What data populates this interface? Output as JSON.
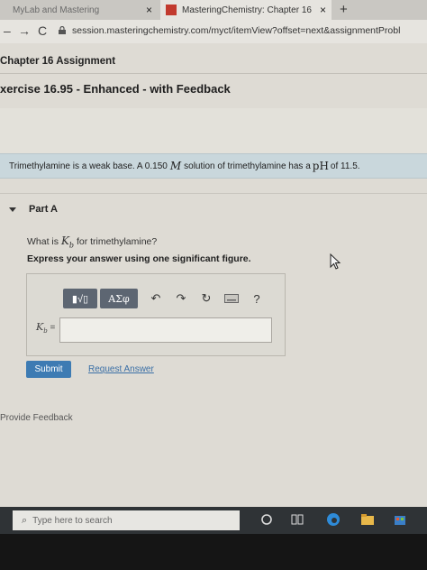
{
  "browser": {
    "tabs": [
      {
        "title": "MyLab and Mastering",
        "active": false
      },
      {
        "title": "MasteringChemistry: Chapter 16",
        "active": true
      }
    ],
    "new_tab_label": "+",
    "close_symbol": "×",
    "url": "session.masteringchemistry.com/myct/itemView?offset=next&assignmentProbl"
  },
  "page": {
    "assignment_title": "Chapter 16 Assignment",
    "exercise_title": "xercise 16.95 - Enhanced - with Feedback",
    "problem": {
      "before_var": "Trimethylamine is a weak base. A 0.150",
      "var": "M",
      "middle": "solution of trimethylamine has a",
      "ph": "pH",
      "after": "of 11.5."
    },
    "part": {
      "label": "Part A",
      "question_before": "What is",
      "question_var": "Kb",
      "question_after": "for trimethylamine?",
      "instruction": "Express your answer using one significant figure.",
      "toolbar": {
        "template_label": "▮√▯",
        "greek_label": "ΑΣφ",
        "undo": "↶",
        "redo": "↷",
        "reset": "↻",
        "help": "?"
      },
      "input_label_var": "Kb",
      "input_label_suffix": "=",
      "input_value": ""
    },
    "submit_label": "Submit",
    "request_answer_label": "Request Answer",
    "provide_feedback_label": "Provide Feedback"
  },
  "taskbar": {
    "search_placeholder": "Type here to search"
  },
  "colors": {
    "submit_bg": "#3d7bb3",
    "link": "#3a6fa6",
    "problem_band": "#c9d7dc",
    "toolbar_btn": "#5d6672",
    "taskbar": "#2f3336"
  }
}
